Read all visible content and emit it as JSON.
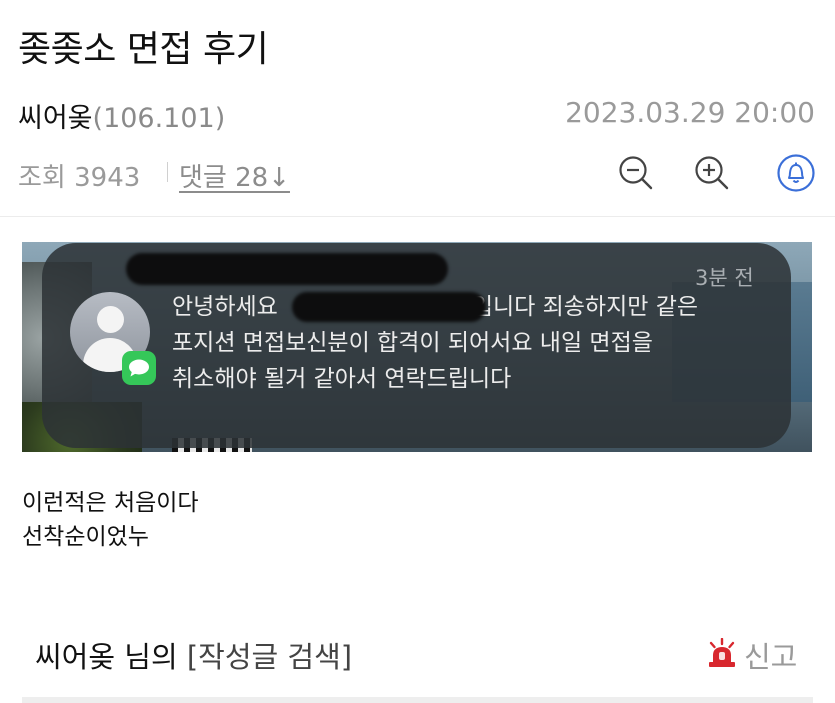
{
  "post": {
    "title": "좆좆소 면접 후기",
    "author": "씨어옺",
    "author_ip": "(106.101)",
    "datetime": "2023.03.29 20:00",
    "views": "조회 3943",
    "comments": "댓글 28↓"
  },
  "toolbar": {
    "zoom_out_icon": "zoom-out-icon",
    "zoom_in_icon": "zoom-in-icon",
    "bell_icon": "bell-icon",
    "accent_color": "#3b6fd8"
  },
  "image": {
    "notification": {
      "time": "3분 전",
      "line1_start": "안녕하세요",
      "line1_end": "입니다 죄송하지만 같은",
      "line2": "포지션 면접보신분이 합격이 되어서요 내일 면접을",
      "line3": "취소해야 될거 같아서 연락드립니다",
      "app_icon": "messages-icon",
      "avatar_icon": "contact-avatar-icon"
    }
  },
  "body": {
    "line1": "이런적은 처음이다",
    "line2": "선착순이었누"
  },
  "footer": {
    "author_name": "씨어옺 님의",
    "search_link": "[작성글 검색]",
    "report_label": "신고",
    "report_icon": "siren-icon",
    "report_color": "#d8272e"
  }
}
